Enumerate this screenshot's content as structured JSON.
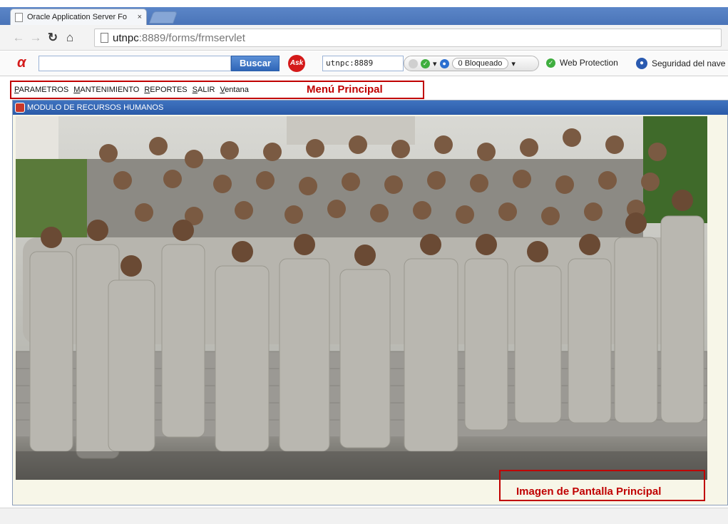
{
  "browser": {
    "tab_title": "Oracle Application Server Fo",
    "tab_close": "×",
    "url_host": "utnpc",
    "url_path": ":8889/forms/frmservlet"
  },
  "ask_toolbar": {
    "search_button": "Buscar",
    "ask_badge": "Ask",
    "host_field": "utnpc:8889",
    "blocked_label": "0 Bloqueado",
    "web_protection": "Web Protection",
    "security_label": "Seguridad del nave"
  },
  "menu": {
    "items": [
      {
        "label": "PARAMETROS"
      },
      {
        "label": "MANTENIMIENTO"
      },
      {
        "label": "REPORTES"
      },
      {
        "label": "SALIR"
      },
      {
        "label": "Ventana"
      }
    ]
  },
  "annotations": {
    "menu_label": "Menú Principal",
    "image_label": "Imagen de Pantalla Principal"
  },
  "forms_window": {
    "title": "MODULO DE RECURSOS HUMANOS"
  },
  "icons": {
    "back": "back-arrow-icon",
    "forward": "forward-arrow-icon",
    "reload": "reload-icon",
    "home": "home-icon",
    "page": "page-icon"
  },
  "colors": {
    "title_bar": "#2a5aa8",
    "annotation": "#c00000",
    "search_button": "#2f66b8"
  }
}
